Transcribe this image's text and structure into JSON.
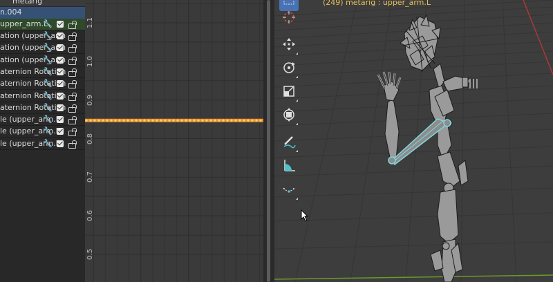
{
  "graph_editor": {
    "channels": {
      "header_object": "metarig",
      "header_action": "n.004",
      "group_name": "upper_arm.L",
      "rows": [
        {
          "label": "ation (upper_arm"
        },
        {
          "label": "ation (upper_arm"
        },
        {
          "label": "ation (upper_arm"
        },
        {
          "label": "aternion Rotation"
        },
        {
          "label": "aternion Rotation"
        },
        {
          "label": "aternion Rotation"
        },
        {
          "label": "aternion Rotation"
        },
        {
          "label": "le (upper_arm.L"
        },
        {
          "label": "le (upper_arm.L"
        },
        {
          "label": "le (upper_arm.L"
        }
      ]
    },
    "y_axis_labels": [
      "1.1",
      "1.0",
      "0.9",
      "0.8",
      "0.7",
      "0.6",
      "0.5"
    ],
    "curve_value": 0.847
  },
  "viewport": {
    "header_text": "(249) metarig : upper_arm.L",
    "tools": [
      "select-box-icon",
      "cursor-icon",
      "move-icon",
      "rotate-icon",
      "scale-icon",
      "transform-icon",
      "annotate-icon",
      "measure-icon",
      "relax-pose-icon"
    ]
  },
  "colors": {
    "curve": "#e8902a",
    "selected_bone": "#7fd8e0",
    "group_row": "#2f4a2a",
    "action_row": "#355276",
    "header_text": "#e6c15a"
  }
}
